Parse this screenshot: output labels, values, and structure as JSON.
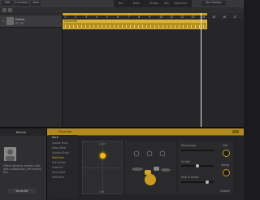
{
  "control_bar": {
    "buttons": [
      "Edit",
      "Functions",
      "View"
    ],
    "lcd_text": [
      "Bar",
      "Beat",
      "Tempo",
      "Key",
      "Signature"
    ],
    "right_label": "No Overlap"
  },
  "track": {
    "name": "Drums",
    "number": "1"
  },
  "ruler": {
    "marks": [
      "1",
      "2",
      "3",
      "4",
      "5",
      "6",
      "7",
      "8",
      "9",
      "10",
      "11",
      "12",
      "13",
      "14",
      "15",
      "16",
      "17"
    ]
  },
  "region": {
    "name": "Drummer"
  },
  "smart_help": {
    "title": "Ritchie",
    "text": "Offers dynamic modern rock, with unobtrusive, yet colorful fills.",
    "button_label": "Drum Kit"
  },
  "drummer_editor": {
    "header": "Drummer",
    "presets": [
      "Rock",
      "Classic Rock",
      "Down Beat",
      "Double Stack",
      "Half-time",
      "Old School",
      "Powerful",
      "Punk Rock",
      "Soft Rock"
    ],
    "selected_preset": "Half-time",
    "pad_labels": {
      "top": "Loud",
      "bottom": "Soft",
      "left": "Simple",
      "right": "Complex"
    },
    "controls": [
      "Percussion",
      "Hi-Hat",
      "Kick & Snare"
    ],
    "fills_label": "Fills",
    "swing_label": "Swing",
    "details_label": "Details"
  },
  "colors": {
    "accent": "#c9a227",
    "background": "#1b1b1d"
  }
}
